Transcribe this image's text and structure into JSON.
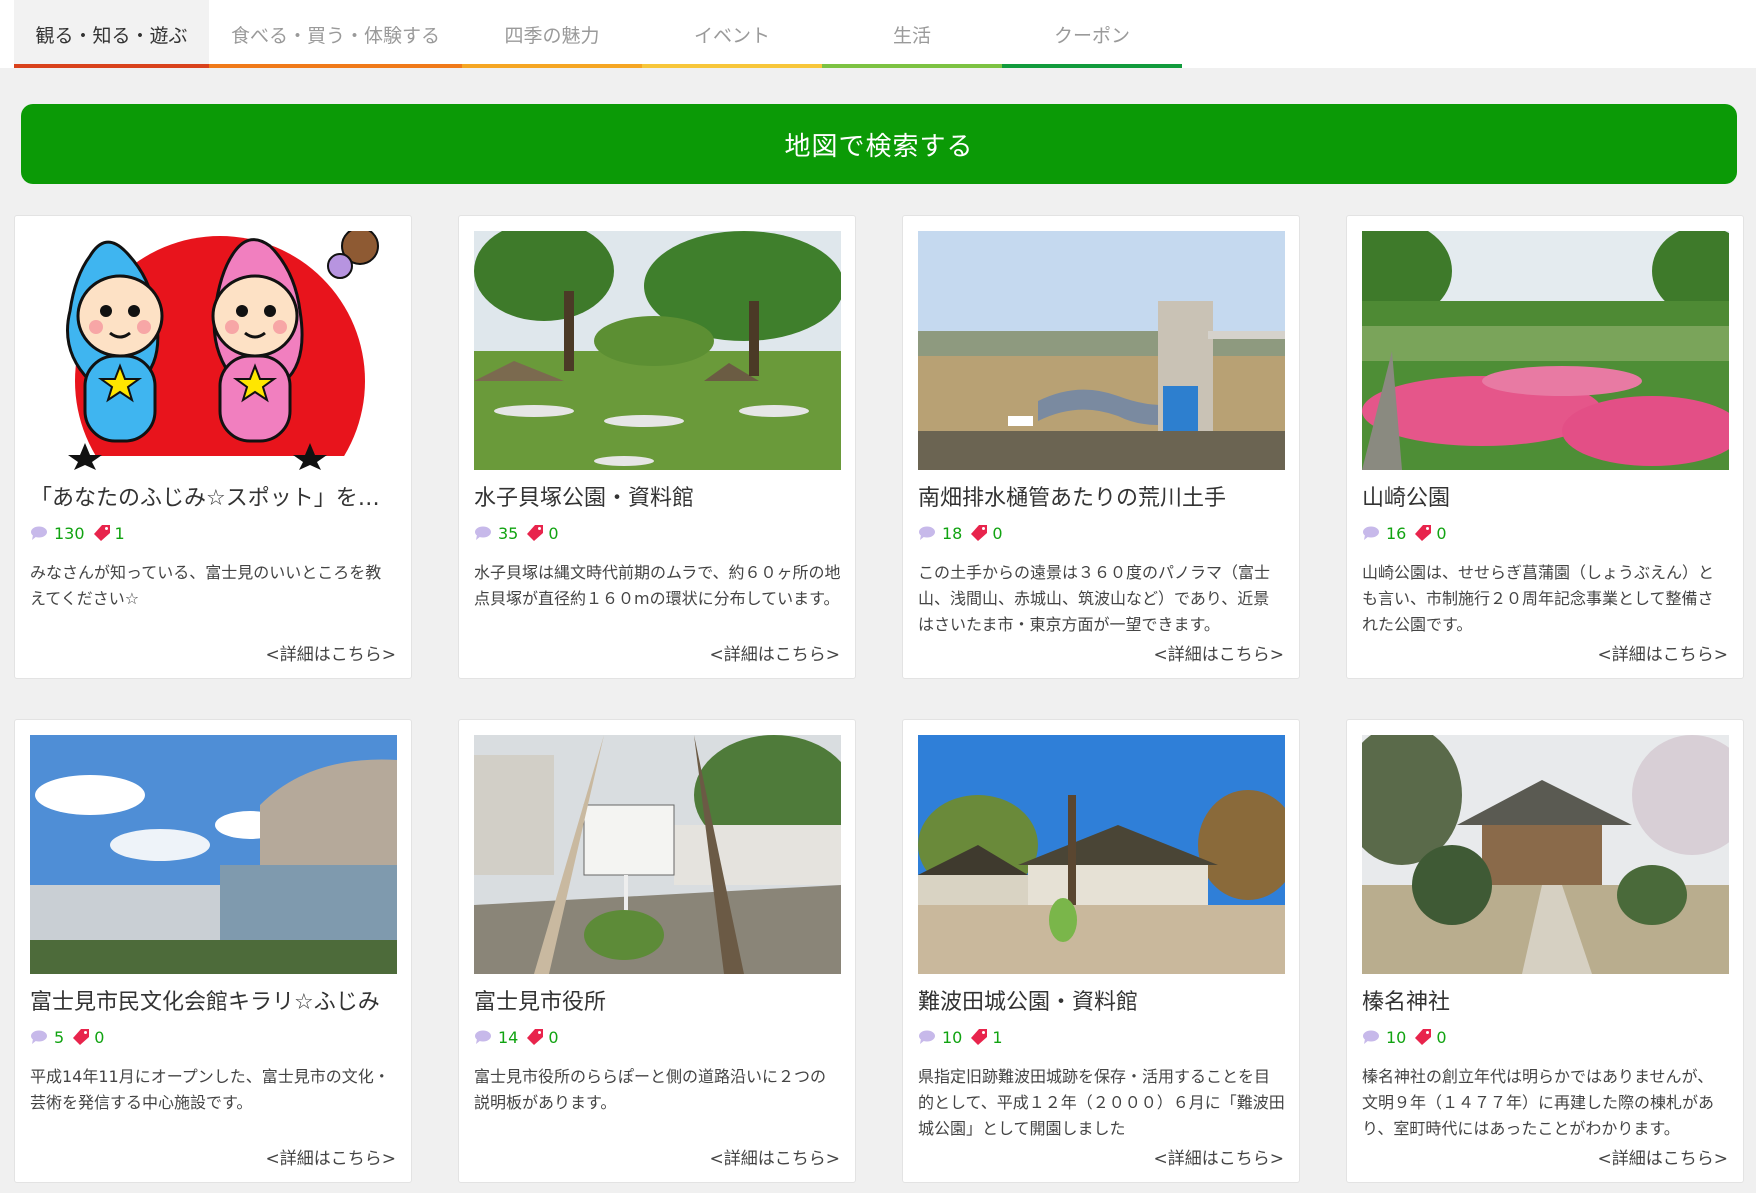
{
  "tabs": [
    {
      "label": "観る・知る・遊ぶ",
      "color": "#d9421c",
      "active": true
    },
    {
      "label": "食べる・買う・体験する",
      "color": "#f07a1a"
    },
    {
      "label": "四季の魅力",
      "color": "#f5a623"
    },
    {
      "label": "イベント",
      "color": "#f7c63a"
    },
    {
      "label": "生活",
      "color": "#7cc242"
    },
    {
      "label": "クーポン",
      "color": "#119b3c"
    }
  ],
  "map_button": {
    "label": "地図で検索する",
    "color": "#0b9a06"
  },
  "more_label": "<詳細はこちら>",
  "cards": [
    {
      "title": "「あなたのふじみ☆スポット」を教えてください",
      "comments": "130",
      "coupons": "1",
      "desc": "みなさんが知っている、富士見のいいところを教えてください☆"
    },
    {
      "title": "水子貝塚公園・資料館",
      "comments": "35",
      "coupons": "0",
      "desc": "水子貝塚は縄文時代前期のムラで、約６０ヶ所の地点貝塚が直径約１６０mの環状に分布しています。"
    },
    {
      "title": "南畑排水樋管あたりの荒川土手",
      "comments": "18",
      "coupons": "0",
      "desc": "この土手からの遠景は３６０度のパノラマ（富士山、浅間山、赤城山、筑波山など）であり、近景はさいたま市・東京方面が一望できます。"
    },
    {
      "title": "山崎公園",
      "comments": "16",
      "coupons": "0",
      "desc": "山崎公園は、せせらぎ菖蒲園（しょうぶえん）とも言い、市制施行２０周年記念事業として整備された公園です。"
    },
    {
      "title": "富士見市民文化会館キラリ☆ふじみ",
      "comments": "5",
      "coupons": "0",
      "desc": "平成14年11月にオープンした、富士見市の文化・芸術を発信する中心施設です。"
    },
    {
      "title": "富士見市役所",
      "comments": "14",
      "coupons": "0",
      "desc": "富士見市役所のららぽーと側の道路沿いに２つの説明板があります。"
    },
    {
      "title": "難波田城公園・資料館",
      "comments": "10",
      "coupons": "1",
      "desc": "県指定旧跡難波田城跡を保存・活用することを目的として、平成１２年（２０００）６月に「難波田城公園」として開園しました"
    },
    {
      "title": "榛名神社",
      "comments": "10",
      "coupons": "0",
      "desc": "榛名神社の創立年代は明らかではありませんが、文明９年（１４７７年）に再建した際の棟札があり、室町時代にはあったことがわかります。"
    }
  ]
}
